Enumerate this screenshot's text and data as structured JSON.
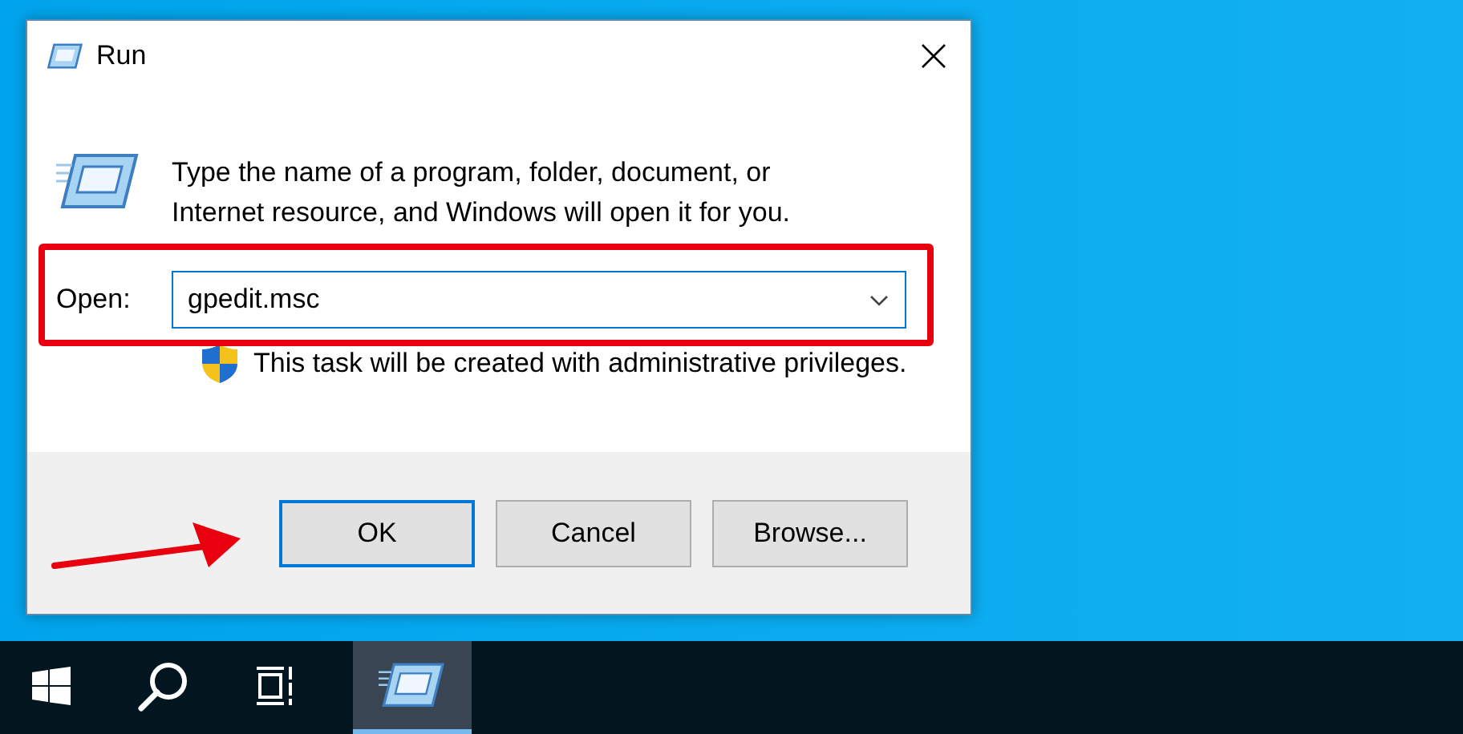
{
  "window": {
    "title": "Run"
  },
  "description": "Type the name of a program, folder, document, or Internet resource, and Windows will open it for you.",
  "open_field": {
    "label": "Open:",
    "value": "gpedit.msc",
    "highlighted": true
  },
  "admin_note": "This task will be created with administrative privileges.",
  "buttons": [
    {
      "label": "OK",
      "default": true
    },
    {
      "label": "Cancel",
      "default": false
    },
    {
      "label": "Browse...",
      "default": false
    }
  ],
  "annotation_arrow": true,
  "taskbar": {
    "items": [
      {
        "kind": "start",
        "selected": false
      },
      {
        "kind": "search",
        "selected": false
      },
      {
        "kind": "taskview",
        "selected": false
      },
      {
        "kind": "run",
        "selected": true
      }
    ]
  }
}
